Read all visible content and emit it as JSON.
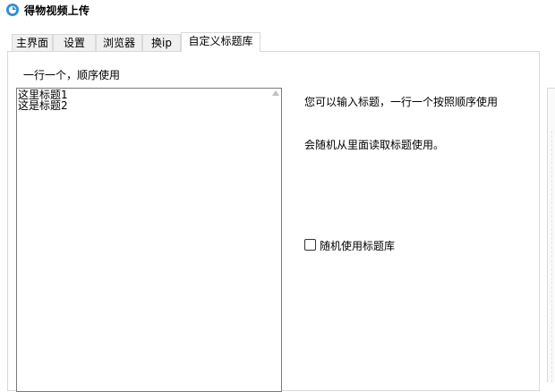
{
  "window": {
    "title": "得物视频上传"
  },
  "tabs": [
    {
      "label": "主界面",
      "active": false
    },
    {
      "label": "设置",
      "active": false
    },
    {
      "label": "浏览器",
      "active": false
    },
    {
      "label": "换ip",
      "active": false
    },
    {
      "label": "自定义标题库",
      "active": true
    }
  ],
  "panel": {
    "hint_label": "一行一个，顺序使用",
    "titles_text": [
      "这里标题1",
      "这是标题2"
    ],
    "description_line1": "您可以输入标题，一行一个按照顺序使用",
    "description_line2": "会随机从里面读取标题使用。",
    "random_checkbox": {
      "label": "随机使用标题库",
      "checked": false
    }
  },
  "colors": {
    "accent": "#2b8fd6"
  }
}
